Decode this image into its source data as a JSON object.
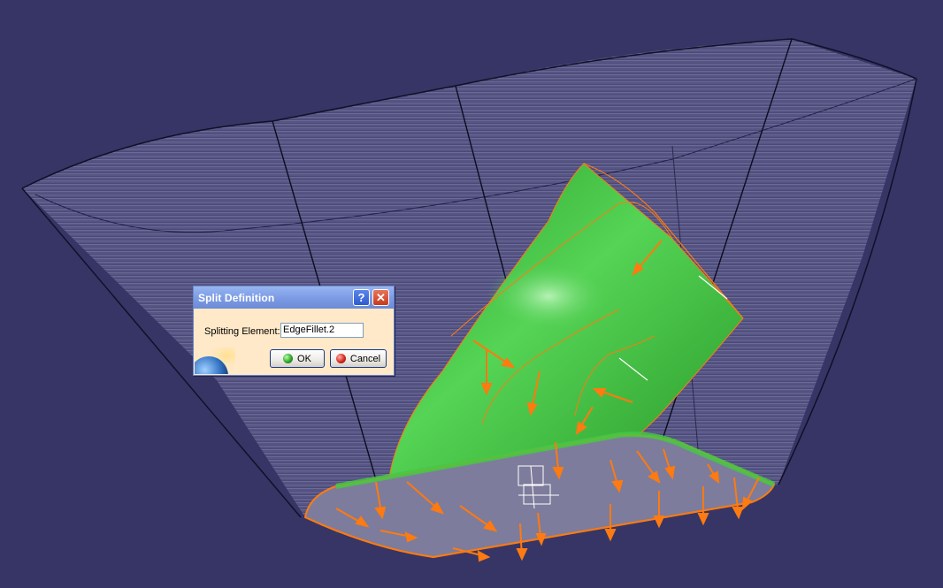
{
  "dialog": {
    "title": "Split Definition",
    "help_icon": "help-icon",
    "close_icon": "close-icon",
    "splitting_label": "Splitting Element:",
    "splitting_value": "EdgeFillet.2",
    "ok_label": "OK",
    "cancel_label": "Cancel"
  },
  "colors": {
    "background": "#363566",
    "surface_green": "#3fbf3f",
    "edge_orange": "#ff7a10",
    "dialog_bg": "#ffe9c8",
    "titlebar": "#7f9ee6"
  }
}
